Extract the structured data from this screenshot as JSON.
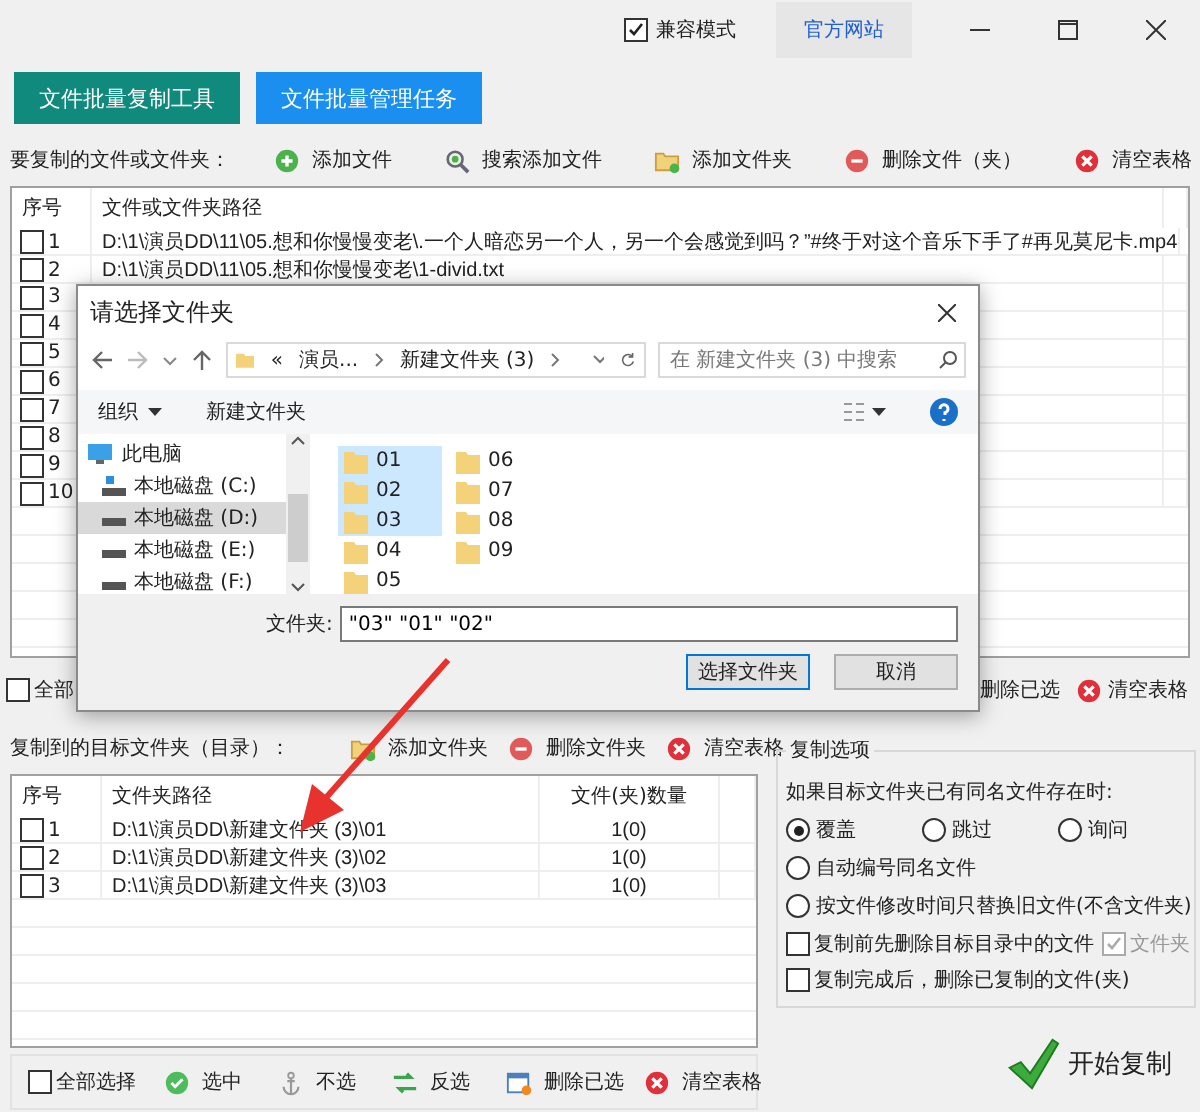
{
  "window": {
    "compat_mode": {
      "label": "兼容模式",
      "checked": true
    },
    "website_link": "官方网站"
  },
  "mode_buttons": [
    {
      "label": "文件批量复制工具",
      "selected": true
    },
    {
      "label": "文件批量管理任务",
      "selected": false
    }
  ],
  "source": {
    "label": "要复制的文件或文件夹：",
    "actions_left": [
      {
        "kind": "add",
        "label": "添加文件"
      },
      {
        "kind": "search",
        "label": "搜索添加文件"
      },
      {
        "kind": "folder",
        "label": "添加文件夹"
      }
    ],
    "actions_right": [
      {
        "kind": "remove",
        "label": "删除文件（夹）"
      },
      {
        "kind": "clear",
        "label": "清空表格"
      }
    ],
    "table": {
      "columns": [
        "序号",
        "文件或文件夹路径"
      ],
      "rows": [
        {
          "index": "1",
          "path": "D:\\1\\演员DD\\11\\05.想和你慢慢变老\\.一个人暗恋另一个人，另一个会感觉到吗？”#终于对这个音乐下手了#再见莫尼卡.mp4",
          "checked": false
        },
        {
          "index": "2",
          "path": "D:\\1\\演员DD\\11\\05.想和你慢慢变老\\1-divid.txt",
          "checked": false
        },
        {
          "index": "3",
          "checked": false
        },
        {
          "index": "4",
          "checked": false
        },
        {
          "index": "5",
          "checked": false
        },
        {
          "index": "6",
          "checked": false
        },
        {
          "index": "7",
          "checked": false
        },
        {
          "index": "8",
          "checked": false
        },
        {
          "index": "9",
          "checked": false
        },
        {
          "index": "10",
          "checked": false
        }
      ]
    },
    "footer": {
      "select_all": {
        "label": "全部",
        "checked": false
      },
      "actions_right": [
        {
          "kind": "plain",
          "label": "删除已选"
        },
        {
          "kind": "clear",
          "label": "清空表格"
        }
      ]
    }
  },
  "target": {
    "label": "复制到的目标文件夹（目录）：",
    "actions": [
      {
        "kind": "folder",
        "label": "添加文件夹"
      },
      {
        "kind": "remove",
        "label": "删除文件夹"
      },
      {
        "kind": "clear",
        "label": "清空表格"
      }
    ],
    "table": {
      "columns": [
        "序号",
        "文件夹路径",
        "文件(夹)数量"
      ],
      "rows": [
        {
          "index": "1",
          "path": "D:\\1\\演员DD\\新建文件夹 (3)\\01",
          "count": "1(0)",
          "checked": false
        },
        {
          "index": "2",
          "path": "D:\\1\\演员DD\\新建文件夹 (3)\\02",
          "count": "1(0)",
          "checked": false
        },
        {
          "index": "3",
          "path": "D:\\1\\演员DD\\新建文件夹 (3)\\03",
          "count": "1(0)",
          "checked": false
        }
      ]
    },
    "footer": {
      "select_all": {
        "label": "全部选择",
        "checked": false
      },
      "actions_left": [
        {
          "kind": "select",
          "label": "选中"
        },
        {
          "kind": "unselect",
          "label": "不选"
        },
        {
          "kind": "invert",
          "label": "反选"
        }
      ],
      "actions_right": [
        {
          "kind": "delete-selected",
          "label": "删除已选"
        },
        {
          "kind": "clear",
          "label": "清空表格"
        }
      ]
    }
  },
  "options": {
    "title": "复制选项",
    "prompt": "如果目标文件夹已有同名文件存在时:",
    "radio_rows": [
      [
        {
          "label": "覆盖",
          "selected": true
        },
        {
          "label": "跳过",
          "selected": false
        },
        {
          "label": "询问",
          "selected": false
        }
      ],
      [
        {
          "label": "自动编号同名文件",
          "selected": false
        }
      ],
      [
        {
          "label": "按文件修改时间只替换旧文件(不含文件夹)",
          "selected": false
        }
      ]
    ],
    "checkbox_rows": [
      [
        {
          "label": "复制前先删除目标目录中的文件",
          "checked": false,
          "disabled": false
        },
        {
          "label": "文件夹",
          "checked": true,
          "disabled": true
        }
      ],
      [
        {
          "label": "复制完成后，删除已复制的文件(夹)",
          "checked": false,
          "disabled": false
        }
      ]
    ]
  },
  "start_button": "开始复制",
  "dialog": {
    "title": "请选择文件夹",
    "breadcrumb_lead": "«",
    "breadcrumb": [
      "演员...",
      "新建文件夹 (3)"
    ],
    "search_placeholder": "在 新建文件夹 (3) 中搜索",
    "toolbar": [
      {
        "label": "组织",
        "dropdown": true
      },
      {
        "label": "新建文件夹",
        "dropdown": false
      }
    ],
    "nav": [
      {
        "kind": "pc",
        "label": "此电脑",
        "selected": false
      },
      {
        "kind": "system-drive",
        "label": "本地磁盘 (C:)",
        "selected": false
      },
      {
        "kind": "drive",
        "label": "本地磁盘 (D:)",
        "selected": true
      },
      {
        "kind": "drive",
        "label": "本地磁盘 (E:)",
        "selected": false
      },
      {
        "kind": "drive",
        "label": "本地磁盘 (F:)",
        "selected": false
      }
    ],
    "folders": [
      {
        "name": "01",
        "selected": true
      },
      {
        "name": "02",
        "selected": true
      },
      {
        "name": "03",
        "selected": true
      },
      {
        "name": "04",
        "selected": false
      },
      {
        "name": "05",
        "selected": false
      },
      {
        "name": "06",
        "selected": false
      },
      {
        "name": "07",
        "selected": false
      },
      {
        "name": "08",
        "selected": false
      },
      {
        "name": "09",
        "selected": false
      }
    ],
    "filename_label": "文件夹:",
    "filename_value": "\"03\" \"01\" \"02\"",
    "buttons": [
      {
        "label": "选择文件夹",
        "default": true
      },
      {
        "label": "取消",
        "default": false
      }
    ]
  }
}
